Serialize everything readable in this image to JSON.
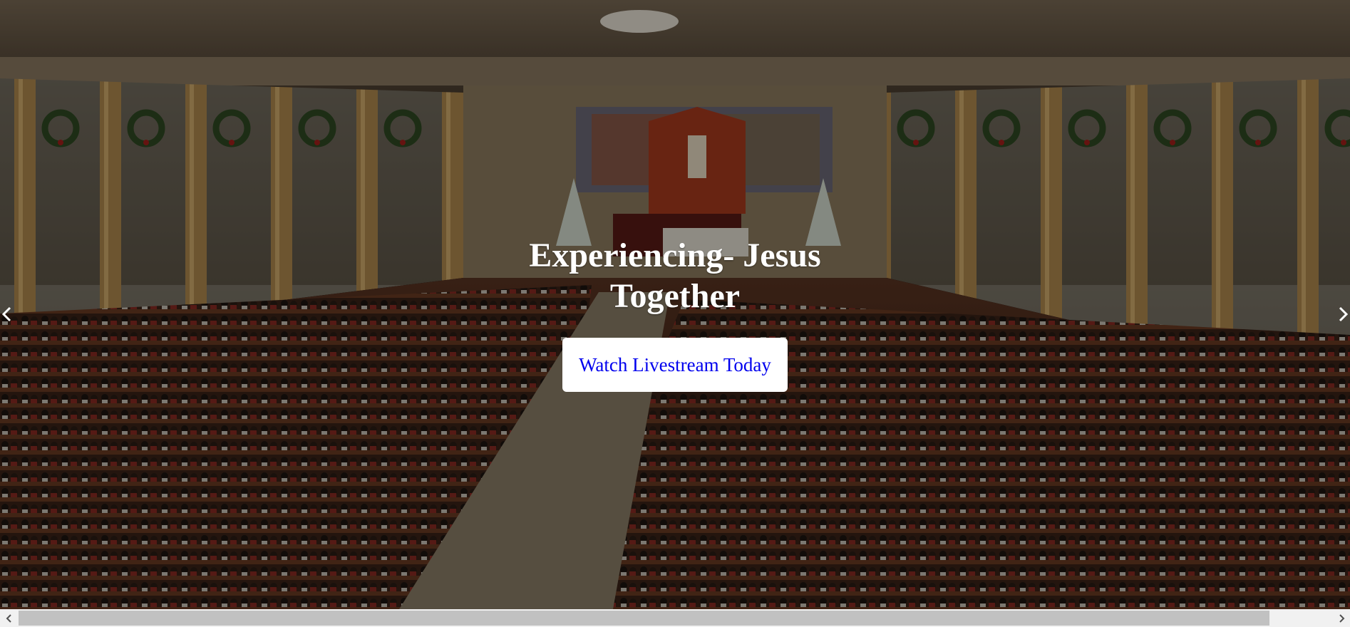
{
  "hero": {
    "title": "Experiencing- Jesus Together",
    "cta_label": "Watch Livestream Today",
    "prev_icon": "chevron-left-icon",
    "next_icon": "chevron-right-icon"
  },
  "scrollbar": {
    "left_icon": "chevron-left-icon",
    "right_icon": "chevron-right-icon"
  },
  "colors": {
    "title": "#ffffff",
    "button_bg": "#ffffff",
    "button_text": "#0000ee",
    "scrollbar_track": "#f1f1f1",
    "scrollbar_thumb": "#c1c1c1"
  }
}
